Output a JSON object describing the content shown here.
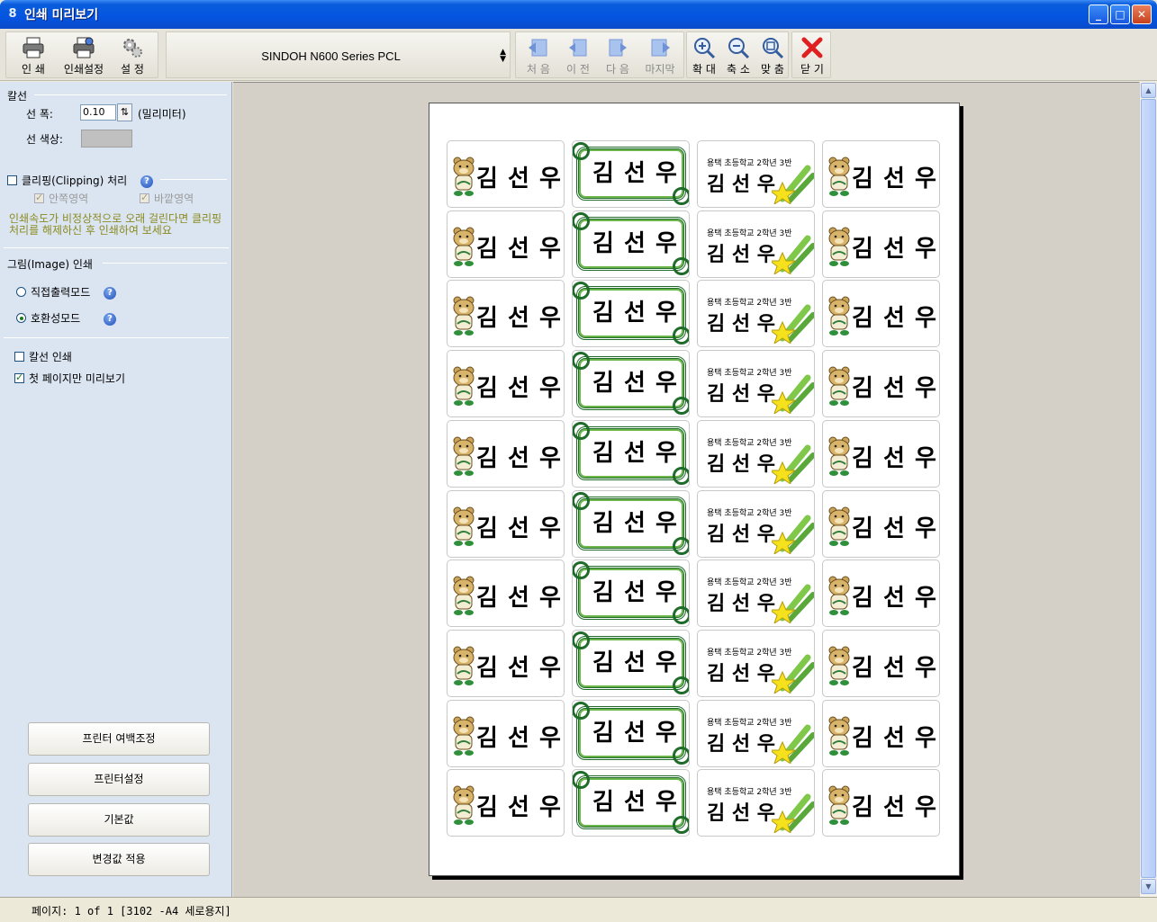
{
  "window": {
    "icon_text": "8",
    "title": "인쇄 미리보기"
  },
  "toolbar": {
    "print": "인 쇄",
    "print_settings": "인쇄설정",
    "settings": "설 정",
    "printer": "SINDOH N600 Series PCL",
    "first": "처 음",
    "prev": "이 전",
    "next": "다 음",
    "last": "마지막",
    "zoom_in": "확 대",
    "zoom_out": "축 소",
    "fit": "맞 춤",
    "close": "닫 기"
  },
  "panel": {
    "ruled_line_header": "칼선",
    "line_width_label": "선 폭:",
    "line_width_value": "0.10",
    "line_width_unit": "(밀리미터)",
    "line_color_label": "선 색상:",
    "clipping_label": "클리핑(Clipping) 처리",
    "inner_area": "안쪽영역",
    "outer_area": "바깥영역",
    "warning": "인쇄속도가 비정상적으로 오래 걸린다면 클리핑처리를 해제하신 후 인쇄하여 보세요",
    "image_print_header": "그림(Image) 인쇄",
    "direct_mode": "직접출력모드",
    "compat_mode": "호환성모드",
    "ruled_print": "칼선 인쇄",
    "first_page_only": "첫 페이지만 미리보기",
    "btn_margin": "프린터 여백조정",
    "btn_printer": "프린터설정",
    "btn_default": "기본값",
    "btn_apply": "변경값 적용"
  },
  "preview": {
    "name": "김 선 우",
    "name_small": "김 선 우",
    "school": "용택 초등학교 2학년 3반",
    "rows": 10,
    "cols": 4
  },
  "status": {
    "text": "페이지: 1 of 1 [3102 -A4 세로용지]"
  },
  "colors": {
    "title_bar": "#0454e1",
    "panel": "#dbe5f2",
    "frame_green": "#1e6b2a",
    "close_red": "#e02020"
  },
  "icons": [
    "printer-icon",
    "printer-settings-icon",
    "gear-icon",
    "first-page-icon",
    "prev-page-icon",
    "next-page-icon",
    "last-page-icon",
    "zoom-in-icon",
    "zoom-out-icon",
    "fit-icon",
    "close-x-icon",
    "help-icon",
    "bear-icon",
    "stars-icon"
  ]
}
